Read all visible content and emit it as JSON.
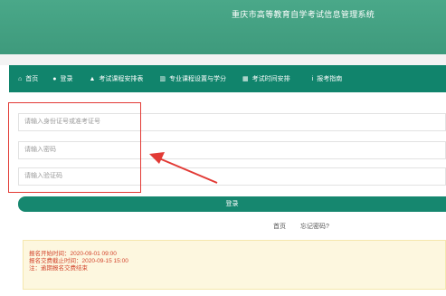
{
  "header": {
    "title": "重庆市高等教育自学考试信息管理系统"
  },
  "nav": {
    "items": [
      {
        "label": "首页",
        "icon": "home-icon",
        "glyph": "⌂"
      },
      {
        "label": "登录",
        "icon": "user-icon",
        "glyph": "●"
      },
      {
        "label": "考试课程安排表",
        "icon": "graduation-cap-icon",
        "glyph": "▲"
      },
      {
        "label": "专业课程设置与学分",
        "icon": "barcode-icon",
        "glyph": "▥"
      },
      {
        "label": "考试时间安排",
        "icon": "calendar-icon",
        "glyph": "▦"
      },
      {
        "label": "报考指南",
        "icon": "info-icon",
        "glyph": "i"
      }
    ]
  },
  "form": {
    "id_placeholder": "请输入身份证号或准考证号",
    "password_placeholder": "请输入密码",
    "captcha_placeholder": "请输入验证码",
    "login_label": "登录",
    "home_link": "首页",
    "forgot_link": "忘记密码?"
  },
  "notice": {
    "lines": [
      "报名开始时间：2020-09-01 09:00",
      "报名交费截止时间：2020-09-15 15:00",
      "注：逾期报名交费结束"
    ]
  },
  "colors": {
    "header": "#45a385",
    "nav": "#11846c",
    "login_button": "#16876f",
    "highlight": "#e23a35",
    "notice_bg": "#fdf7df",
    "notice_text": "#d2442c"
  }
}
